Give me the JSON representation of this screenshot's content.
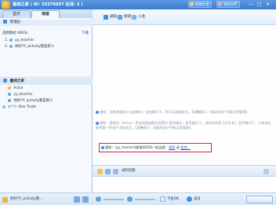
{
  "window": {
    "title": "童线之家 ( ID: 10370057 在线: 3 )",
    "buttons": [
      {
        "label": "音效大全",
        "icon": "sound-icon"
      },
      {
        "label": "音乐大厅",
        "icon": "music-icon"
      }
    ],
    "controls": [
      "—",
      "□",
      "×"
    ]
  },
  "left": {
    "tabs": [
      "首页",
      "频道"
    ],
    "manager_section": "管理员",
    "mode_label": "选择模式 0003s",
    "mode_action": "下播",
    "queue": [
      {
        "num": "1.",
        "name": "yy_teacher"
      },
      {
        "num": "2.",
        "name": "你好YY_activity我是新人"
      }
    ],
    "channel_tree": {
      "root": "童线之家",
      "members": [
        "Ackar",
        "yy_teacher",
        "你好YY_activity我是新人",
        "Star Trade"
      ],
      "members_prefix": "(/-*-)-"
    },
    "bottom_user": "你好YY_activity我…"
  },
  "right": {
    "toolbar": [
      {
        "label": "通知",
        "icon": "notice-icon"
      },
      {
        "label": "频道",
        "icon": "channel-icon"
      },
      {
        "label": "入会",
        "icon": "join-icon"
      }
    ],
    "notices": [
      {
        "text": "通知：当前频道处于自由模式；自由模式下，你可以随意发言。【温馨提示：同级的用户不能互相管理】"
      },
      {
        "text": "通知：管理员（Ackar）把当前频道模式设置为 麦序模式；麦序模式下，选择时间是 3333 秒；麦序模式下，只有排在麦序第一的用户才能发言。【温馨提示：同级的用户不能互相管理】"
      },
      {
        "prefix": "通知：",
        "user": "[yy_teacher]",
        "text_mid": "邀请你同Ta一起连麦：",
        "accept": "接受",
        "or": "或",
        "reject": "拒绝。"
      }
    ],
    "input_toolbar": {
      "send_label": "录制问题"
    },
    "bottom": {
      "mic_label": "卡拉OK",
      "quality_label": "录音"
    }
  }
}
